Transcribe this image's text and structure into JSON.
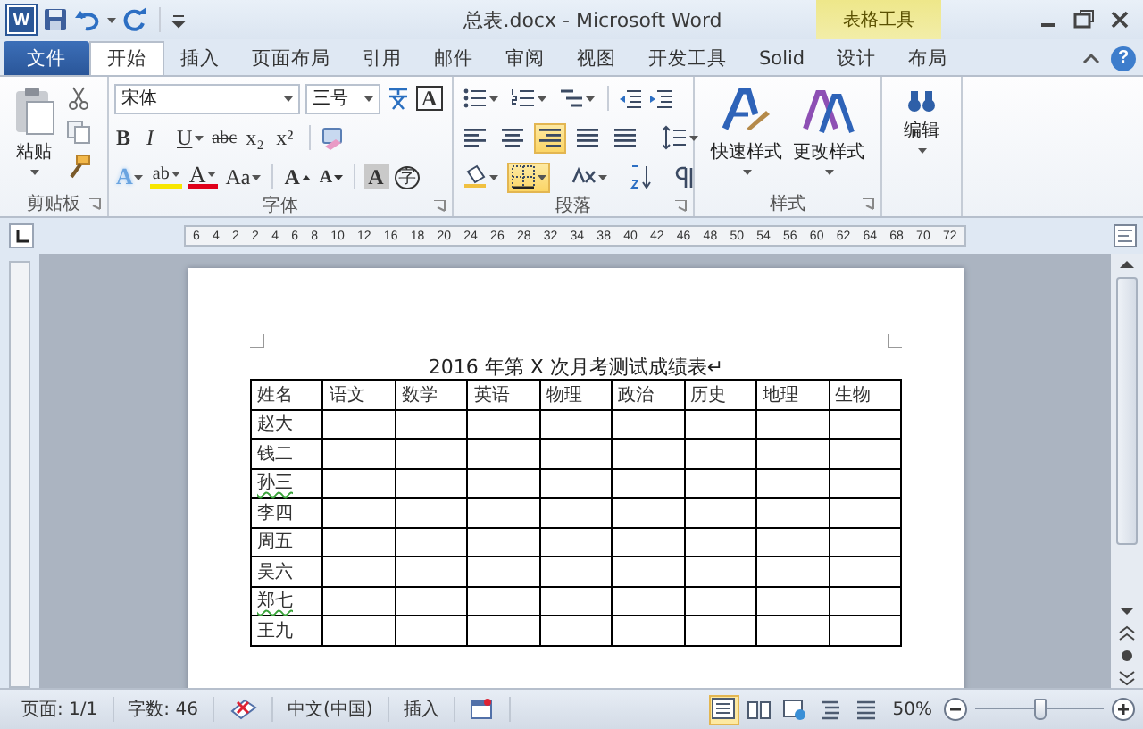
{
  "window": {
    "app_icon": "W",
    "title": "总表.docx - Microsoft Word",
    "context_header": "表格工具",
    "help": "?"
  },
  "tabs": [
    {
      "label": "文件",
      "kind": "file",
      "selected": false
    },
    {
      "label": "开始",
      "kind": "main",
      "selected": true
    },
    {
      "label": "插入",
      "kind": "main",
      "selected": false
    },
    {
      "label": "页面布局",
      "kind": "main",
      "selected": false
    },
    {
      "label": "引用",
      "kind": "main",
      "selected": false
    },
    {
      "label": "邮件",
      "kind": "main",
      "selected": false
    },
    {
      "label": "审阅",
      "kind": "main",
      "selected": false
    },
    {
      "label": "视图",
      "kind": "main",
      "selected": false
    },
    {
      "label": "开发工具",
      "kind": "main",
      "selected": false
    },
    {
      "label": "Solid",
      "kind": "main",
      "selected": false
    },
    {
      "label": "设计",
      "kind": "context",
      "selected": false
    },
    {
      "label": "布局",
      "kind": "context",
      "selected": false
    }
  ],
  "clipboard": {
    "paste": "粘贴",
    "label": "剪贴板"
  },
  "font": {
    "name": "宋体",
    "size": "三号",
    "label": "字体",
    "border_button": "A",
    "row2": [
      {
        "text": "B",
        "kind": "bold",
        "dropdown": false
      },
      {
        "text": "I",
        "kind": "italic",
        "dropdown": false
      },
      {
        "text": "U",
        "kind": "underline",
        "dropdown": true
      },
      {
        "text": "abc",
        "kind": "strike",
        "dropdown": false
      },
      {
        "text": "x₂",
        "kind": "subscript",
        "dropdown": false
      },
      {
        "text": "x²",
        "kind": "superscript",
        "dropdown": false
      }
    ],
    "row3": [
      {
        "text": "A",
        "kind": "effect",
        "dropdown": true
      },
      {
        "text": "ab",
        "kind": "highlight",
        "dropdown": true
      },
      {
        "text": "A",
        "kind": "color",
        "dropdown": true
      },
      {
        "text": "Aa",
        "kind": "case",
        "dropdown": true
      },
      {
        "text": "A",
        "kind": "grow",
        "dropdown": false
      },
      {
        "text": "A",
        "kind": "shrink",
        "dropdown": false
      },
      {
        "text": "A",
        "kind": "shade",
        "dropdown": false
      },
      {
        "text": "字",
        "kind": "enclose",
        "dropdown": false
      }
    ]
  },
  "paragraph": {
    "label": "段落",
    "alignments": [
      {
        "kind": "left",
        "selected": false
      },
      {
        "kind": "center",
        "selected": false
      },
      {
        "kind": "right",
        "selected": true
      },
      {
        "kind": "justify",
        "selected": false
      },
      {
        "kind": "distributed",
        "selected": false
      }
    ],
    "borders_selected": true
  },
  "styles": {
    "label": "样式",
    "buttons": [
      {
        "label": "快速样式",
        "kind": "quick"
      },
      {
        "label": "更改样式",
        "kind": "change"
      }
    ]
  },
  "editing": {
    "label": "编辑"
  },
  "ruler": {
    "labels": [
      "6",
      "4",
      "2",
      "2",
      "4",
      "6",
      "8",
      "10",
      "12",
      "16",
      "18",
      "20",
      "24",
      "26",
      "28",
      "32",
      "34",
      "38",
      "40",
      "42",
      "46",
      "48",
      "50",
      "54",
      "56",
      "60",
      "62",
      "64",
      "68",
      "70",
      "72"
    ]
  },
  "document": {
    "title": "2016 年第 X 次月考测试成绩表↵",
    "columns": [
      "姓名",
      "语文",
      "数学",
      "英语",
      "物理",
      "政治",
      "历史",
      "地理",
      "生物"
    ],
    "rows": [
      {
        "name": "赵大",
        "flagged": false
      },
      {
        "name": "钱二",
        "flagged": false
      },
      {
        "name": "孙三",
        "flagged": true
      },
      {
        "name": "李四",
        "flagged": false
      },
      {
        "name": "周五",
        "flagged": false
      },
      {
        "name": "吴六",
        "flagged": false
      },
      {
        "name": "郑七",
        "flagged": true
      },
      {
        "name": "王九",
        "flagged": false
      }
    ]
  },
  "status_bar": {
    "page": "页面: 1/1",
    "words": "字数: 46",
    "language": "中文(中国)",
    "mode": "插入",
    "views": [
      {
        "kind": "print",
        "selected": true
      },
      {
        "kind": "reading",
        "selected": false
      },
      {
        "kind": "web",
        "selected": false
      },
      {
        "kind": "outline",
        "selected": false
      },
      {
        "kind": "draft",
        "selected": false
      }
    ],
    "zoom": "50%",
    "zoom_slider": {
      "level": 0.5
    }
  }
}
